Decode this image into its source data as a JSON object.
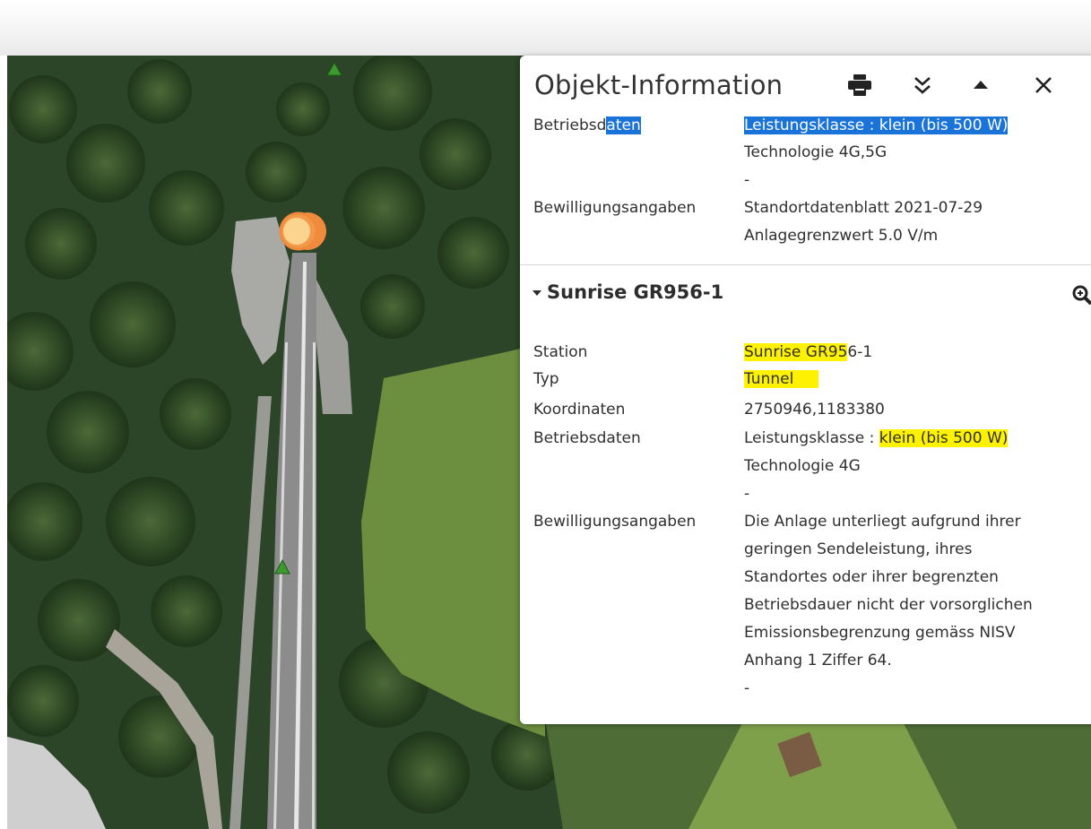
{
  "panel": {
    "title": "Objekt-Information",
    "buttons": {
      "print": "print-icon",
      "expand": "double-chevron-down-icon",
      "collapse": "caret-up-icon",
      "close": "close-icon"
    }
  },
  "prev_entry": {
    "betriebsdaten_label_a": "Betriebsd",
    "betriebsdaten_label_b": "aten",
    "betriebsdaten_values": [
      "Leistungsklasse : klein (bis 500 W)",
      "Technologie 4G,5G",
      "-"
    ],
    "bewilligung_label": "Bewilligungsangaben",
    "bewilligung_values": [
      "Standortdatenblatt 2021-07-29",
      "Anlagegrenzwert 5.0 V/m"
    ]
  },
  "entry": {
    "title": "Sunrise GR956-1",
    "station_label": "Station",
    "station_value_hl": "Sunrise GR95",
    "station_value_rest": "6-1",
    "typ_label": "Typ",
    "typ_value": "Tunnel",
    "koordinaten_label": "Koordinaten",
    "koordinaten_value": "2750946,1183380",
    "betriebsdaten_label": "Betriebsdaten",
    "betriebsdaten_prefix": "Leistungsklasse : ",
    "betriebsdaten_hl": "klein (bis 500 W)",
    "betriebsdaten_tech": "Technologie 4G",
    "betriebsdaten_dash": "-",
    "bewilligung_label": "Bewilligungsangaben",
    "bewilligung_lines": [
      "Die Anlage unterliegt aufgrund ihrer",
      "geringen Sendeleistung, ihres",
      "Standortes oder ihrer begrenzten",
      "Betriebsdauer nicht der vorsorglichen",
      "Emissionsbegrenzung gemäss NISV",
      "Anhang 1 Ziffer 64.",
      "-"
    ]
  },
  "map": {
    "marker_color": "#f08a3c",
    "marker_fill": "#fbd58f",
    "triangle_color": "#3d9a2f"
  }
}
